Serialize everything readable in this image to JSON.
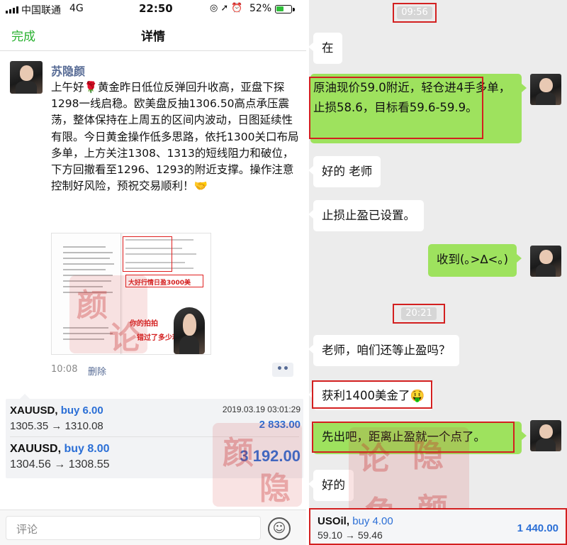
{
  "status_bar": {
    "carrier": "中国联通",
    "network": "4G",
    "time": "22:50",
    "battery_percent": "52%",
    "battery_level": 0.52
  },
  "nav": {
    "done_label": "完成",
    "title": "详情"
  },
  "post": {
    "author": "苏隐颜",
    "body_before_emoji": "上午好",
    "body_emoji": "🌹",
    "body_after_emoji": "黄金昨日低位反弹回升收高，亚盘下探1298一线启稳。欧美盘反抽1306.50高点承压震荡，整体保持在上周五的区间内波动，日图延续性有限。今日黄金操作低多思路，依托1300关口布局多单，上方关注1308、1313的短线阻力和破位，下方回撤看至1296、1293的附近支撑。操作注意控制好风险，预祝交易顺利！",
    "body_end_emoji": "🤝",
    "time": "10:08",
    "delete_label": "删除",
    "more_icon": "••",
    "thumbnail": {
      "caption1": "大好行情日盈3000美",
      "caption2": "你的拍拍",
      "caption3": "错过了多少利润？"
    }
  },
  "trades_left": [
    {
      "symbol": "XAUUSD,",
      "action": "buy 6.00",
      "range": "1305.35 → 1310.08",
      "date": "2019.03.19 03:01:29",
      "profit": "2 833.00"
    },
    {
      "symbol": "XAUUSD,",
      "action": "buy 8.00",
      "range": "1304.56 → 1308.55",
      "date": "",
      "profit": "3 192.00"
    }
  ],
  "comment_bar": {
    "placeholder": "评论",
    "emoji_icon": "☺"
  },
  "chat": {
    "timestamps": [
      "09:56",
      "20:21"
    ],
    "messages": [
      {
        "dir": "in",
        "text": "在"
      },
      {
        "dir": "out",
        "text": "原油现价59.0附近，轻仓进4手多单，止损58.6，目标看59.6-59.9。"
      },
      {
        "dir": "in",
        "text": "好的  老师"
      },
      {
        "dir": "in",
        "text": "止损止盈已设置。"
      },
      {
        "dir": "out",
        "text": "收到(｡>∆<｡)"
      },
      {
        "dir": "in",
        "text": "老师，咱们还等止盈吗？"
      },
      {
        "dir": "in",
        "text": "获利1400美金了🤑"
      },
      {
        "dir": "out",
        "text": "先出吧，距离止盈就一个点了。"
      },
      {
        "dir": "in",
        "text": "好的"
      }
    ],
    "trade": {
      "symbol": "USOil,",
      "action": "buy 4.00",
      "range": "59.10 → 59.46",
      "profit": "1 440.00"
    }
  },
  "colors": {
    "wechat_green": "#27b02e",
    "link_blue": "#576b95",
    "profit_blue": "#2b6fd6",
    "out_bubble": "#9ee25e",
    "annotation_red": "#d32020"
  }
}
